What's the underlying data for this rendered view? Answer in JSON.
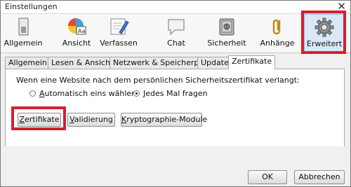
{
  "window": {
    "title": "Einstellungen",
    "close_glyph": "✕"
  },
  "toolbar": {
    "items": [
      {
        "label": "Allgemein",
        "icon": "switch-icon"
      },
      {
        "label": "Ansicht",
        "icon": "palette-icon"
      },
      {
        "label": "Verfassen",
        "icon": "pen-icon"
      },
      {
        "label": "Chat",
        "icon": "speech-bubble-icon"
      },
      {
        "label": "Sicherheit",
        "icon": "safe-icon"
      },
      {
        "label": "Anhänge",
        "icon": "paperclip-icon"
      },
      {
        "label": "Erweitert",
        "icon": "gear-icon"
      }
    ],
    "selected": "Erweitert"
  },
  "tabs": [
    {
      "label": "Allgemein"
    },
    {
      "label": "Lesen & Ansicht"
    },
    {
      "label": "Netzwerk & Speicherplatz"
    },
    {
      "label": "Update"
    },
    {
      "label": "Zertifikate",
      "active": true
    }
  ],
  "certificates": {
    "prompt_text": "Wenn eine Website nach dem persönlichen Sicherheitszertifikat verlangt:",
    "options": [
      {
        "label_underline": "A",
        "label_rest": "utomatisch eins wählen",
        "checked": false
      },
      {
        "label_underline": "J",
        "label_rest": "edes Mal fragen",
        "checked": true
      }
    ],
    "buttons": {
      "certificates": {
        "underline": "Z",
        "rest": "ertifikate"
      },
      "validation": {
        "underline": "V",
        "rest": "alidierung"
      },
      "crypto_modules": {
        "underline": "K",
        "rest": "ryptographie-Module"
      }
    }
  },
  "footer": {
    "ok_label": "OK",
    "cancel_label": "Abbrechen"
  },
  "colors": {
    "highlight": "#d32030",
    "selected_pane": "#d9e8f7"
  }
}
